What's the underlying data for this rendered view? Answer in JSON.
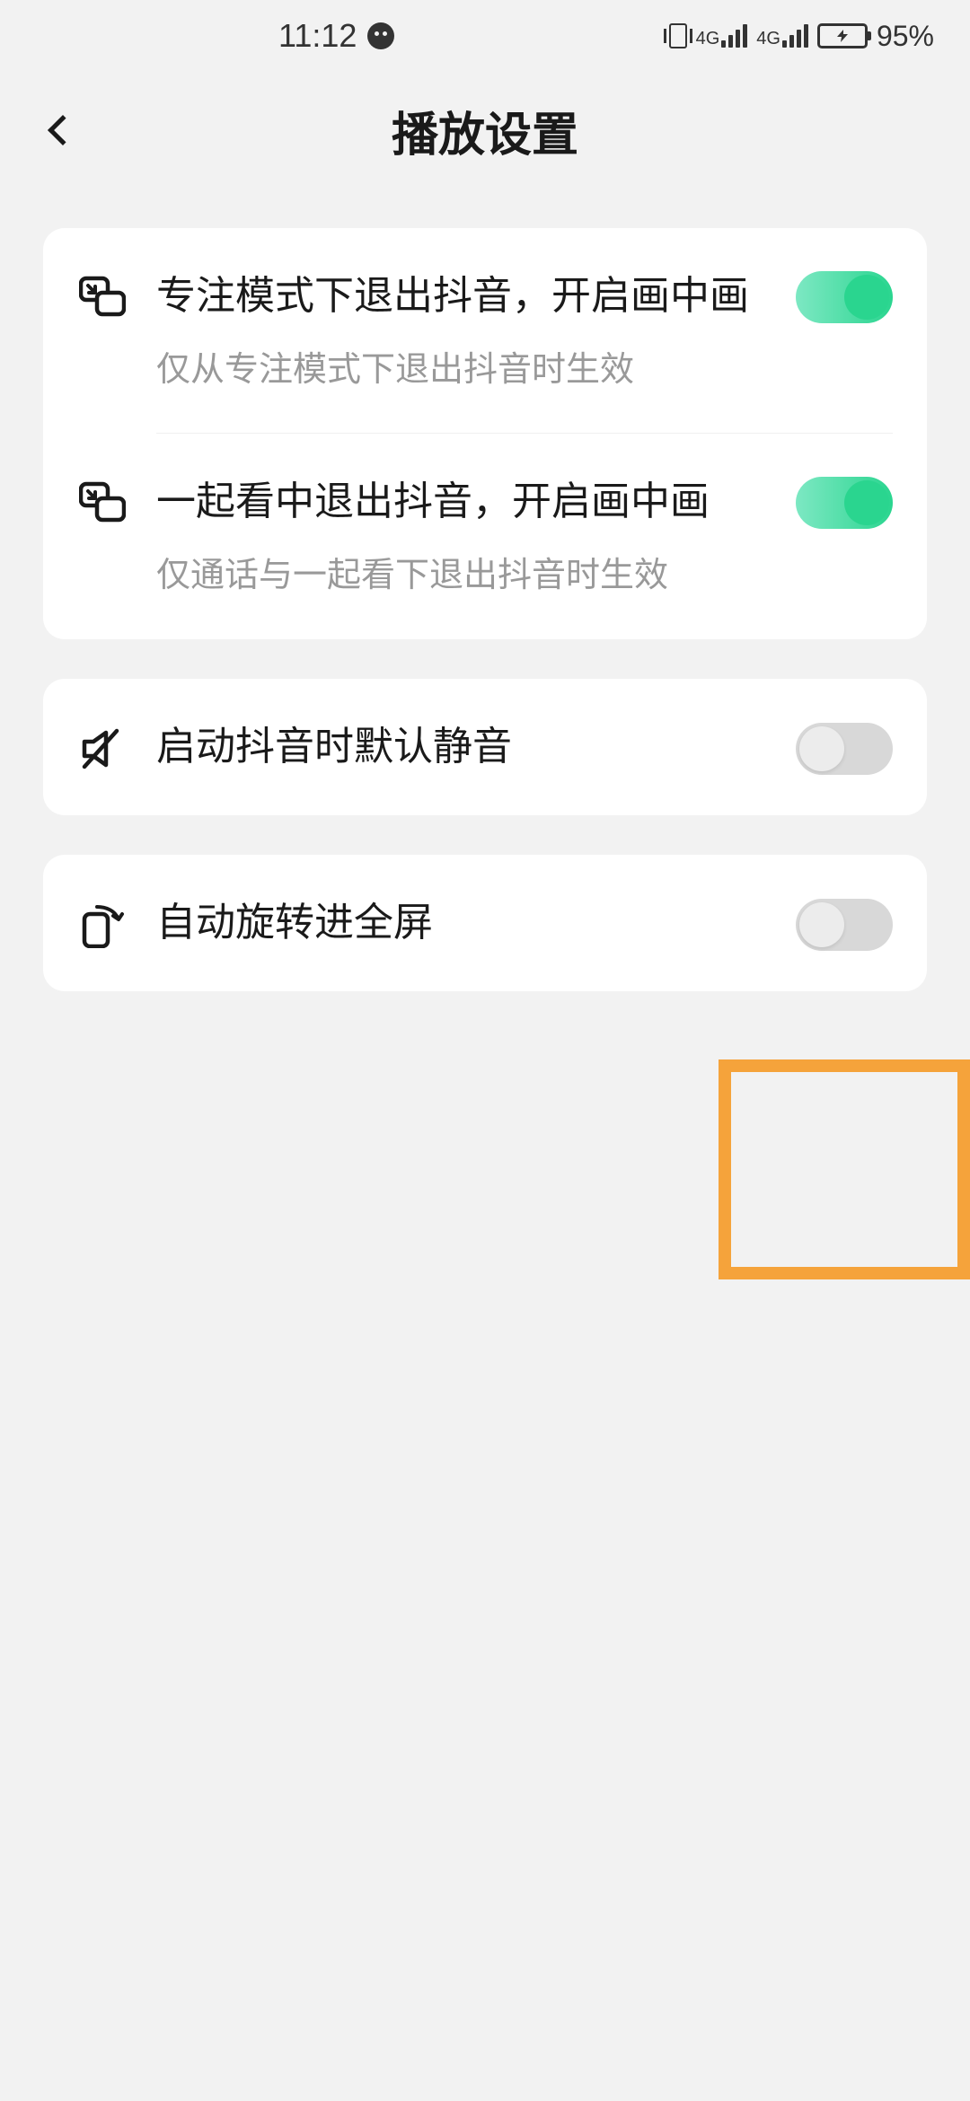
{
  "statusBar": {
    "time": "11:12",
    "battery": "95%"
  },
  "header": {
    "title": "播放设置"
  },
  "group1": {
    "item1": {
      "title": "专注模式下退出抖音，开启画中画",
      "subtitle": "仅从专注模式下退出抖音时生效"
    },
    "item2": {
      "title": "一起看中退出抖音，开启画中画",
      "subtitle": "仅通话与一起看下退出抖音时生效"
    }
  },
  "group2": {
    "item1": {
      "title": "启动抖音时默认静音"
    }
  },
  "group3": {
    "item1": {
      "title": "自动旋转进全屏"
    }
  }
}
